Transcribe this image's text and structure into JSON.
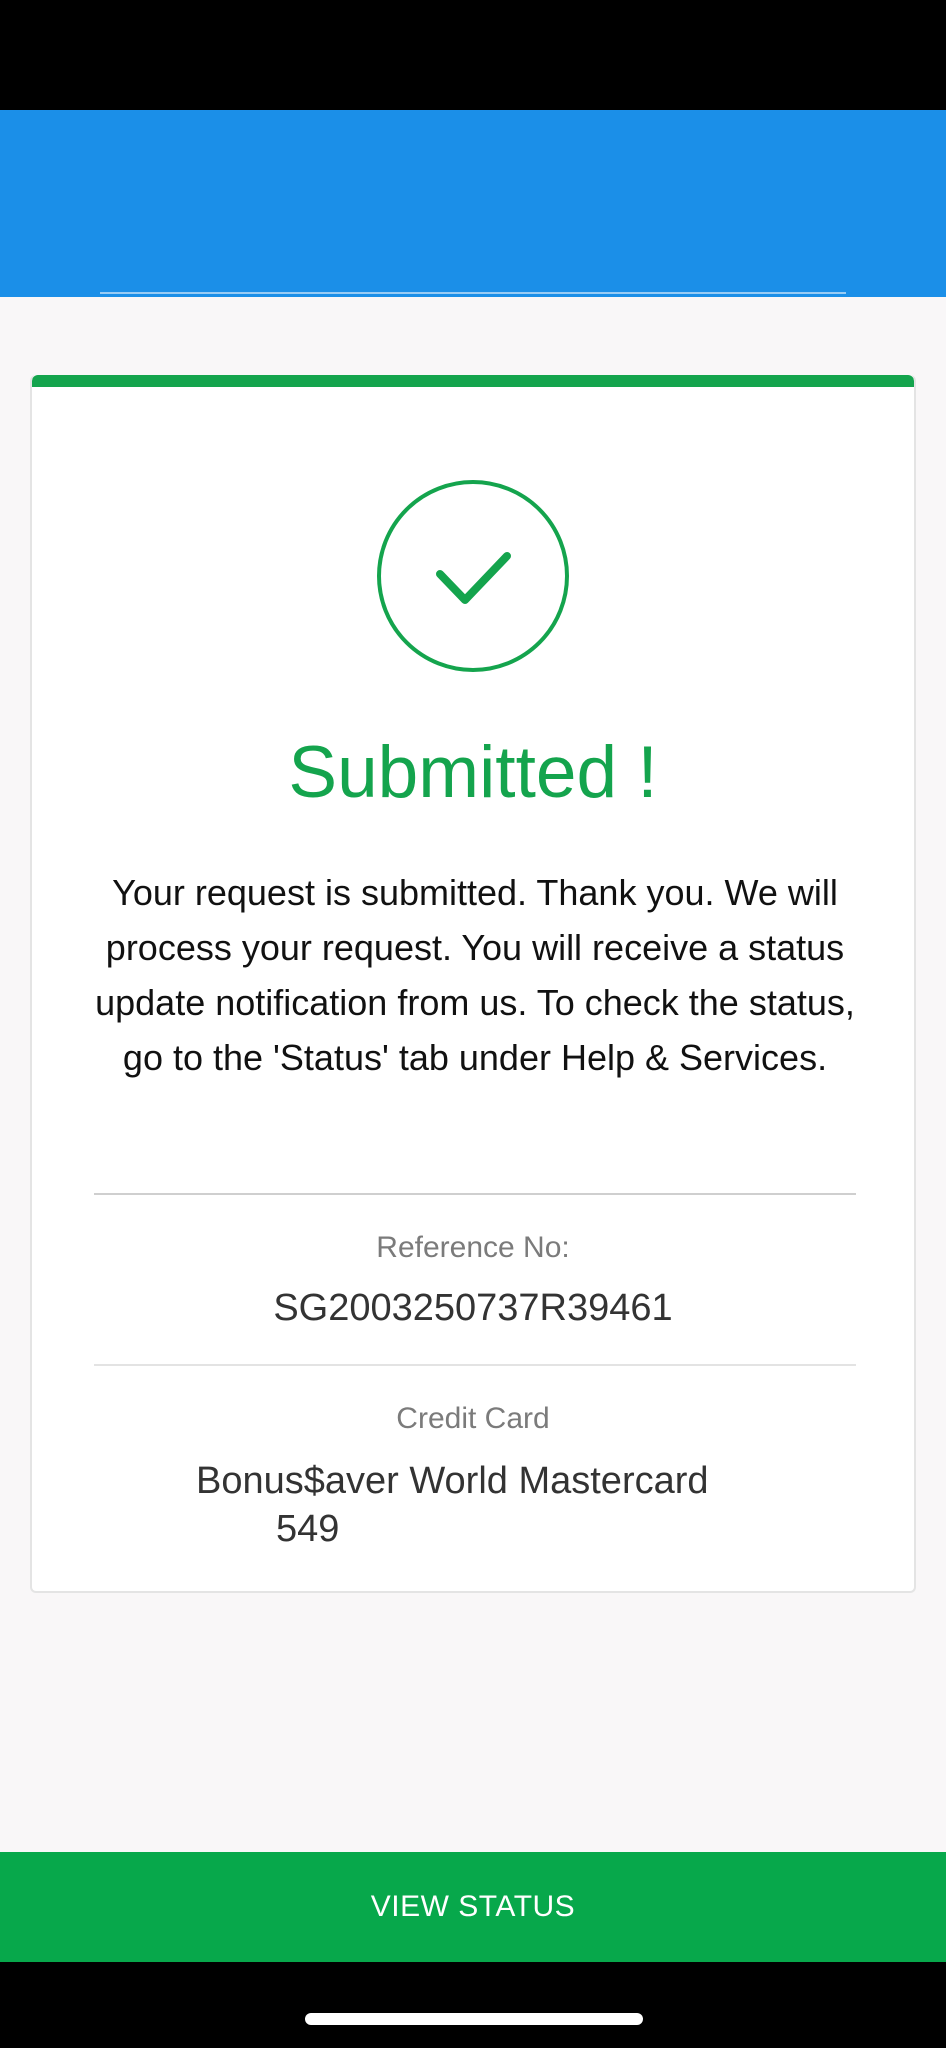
{
  "header": {
    "close_icon": "close-icon",
    "background_color": "#1b8fe8"
  },
  "confirmation": {
    "icon": "check-circle-icon",
    "title": "Submitted !",
    "message": "Your request is submitted. Thank you. We will process your request. You will receive a status update notification from us. To check the status, go to the 'Status' tab under Help & Services.",
    "accent_color": "#14a44d"
  },
  "reference": {
    "label": "Reference No:",
    "value": "SG2003250737R39461"
  },
  "credit_card": {
    "label": "Credit Card",
    "name": "Bonus$aver World Mastercard",
    "number": "549"
  },
  "footer": {
    "view_status_label": "VIEW STATUS",
    "button_color": "#07a84b"
  }
}
